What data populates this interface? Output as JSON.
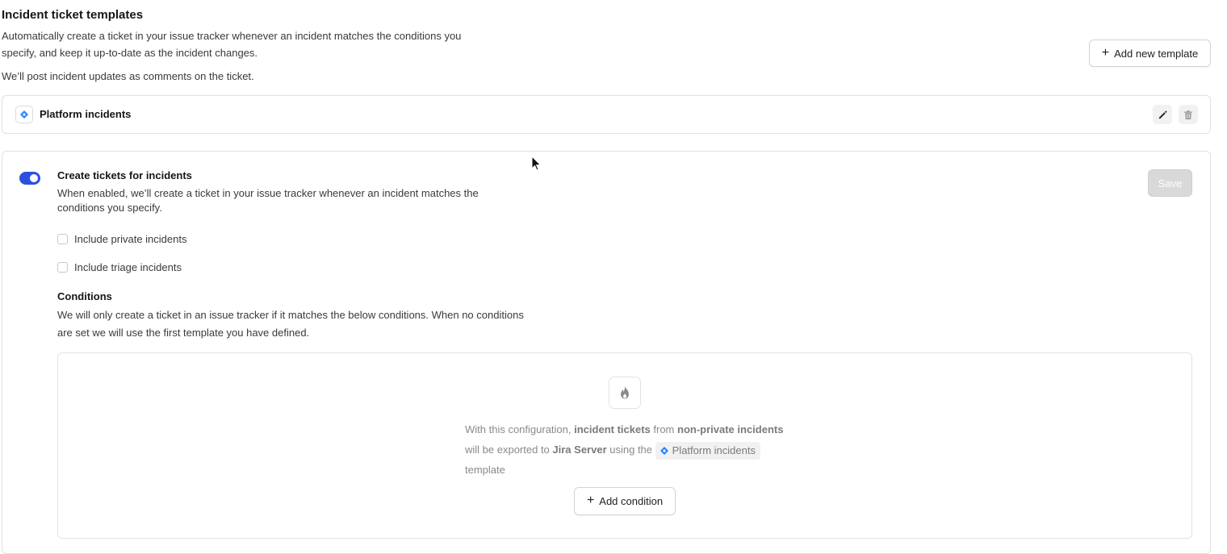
{
  "header": {
    "title": "Incident ticket templates",
    "description": "Automatically create a ticket in your issue tracker whenever an incident matches the conditions you specify, and keep it up-to-date as the incident changes.",
    "note": "We’ll post incident updates as comments on the ticket.",
    "add_button_label": "Add new template"
  },
  "template": {
    "name": "Platform incidents",
    "icon": "jira-icon",
    "edit_icon": "pencil-icon",
    "delete_icon": "trash-icon"
  },
  "settings": {
    "toggle_enabled": true,
    "title": "Create tickets for incidents",
    "description": "When enabled, we’ll create a ticket in your issue tracker whenever an incident matches the conditions you specify.",
    "save_label": "Save",
    "checkboxes": [
      {
        "label": "Include private incidents",
        "checked": false
      },
      {
        "label": "Include triage incidents",
        "checked": false
      }
    ]
  },
  "conditions": {
    "title": "Conditions",
    "description": "We will only create a ticket in an issue tracker if it matches the below conditions. When no conditions are set we will use the first template you have defined.",
    "empty_icon": "flame-icon",
    "summary": {
      "part1": "With this configuration, ",
      "bold1": "incident tickets",
      "part2": " from ",
      "bold2": "non-private incidents",
      "part3": " will be exported to ",
      "bold3": "Jira Server",
      "part4": " using the ",
      "chip_label": "Platform incidents",
      "part5": " template"
    },
    "add_condition_label": "Add condition"
  },
  "colors": {
    "accent": "#2d4fe0",
    "jira_blue": "#2684ff",
    "save_disabled": "#d9d9d9"
  }
}
